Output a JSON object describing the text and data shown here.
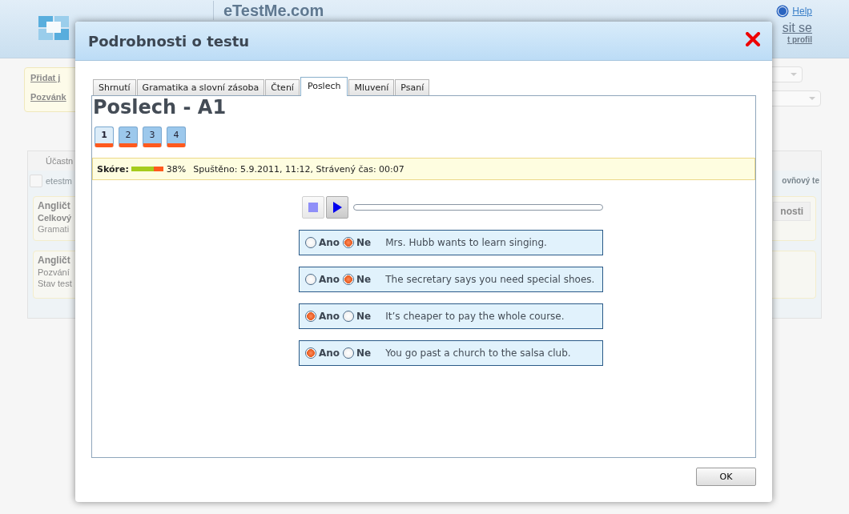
{
  "background": {
    "site_title": "eTestMe.com",
    "help": "Help",
    "login": "sit se",
    "profile": "t profil",
    "invite_box": [
      "Přidat j",
      "Pozvánk"
    ],
    "table": {
      "column_1": "Účastn",
      "row_1": "etestm",
      "right_header": "ovňový te",
      "cards": [
        {
          "title": "Angličt",
          "lines": [
            "Celkový",
            "Gramati"
          ],
          "button": "nosti"
        },
        {
          "title": "Angličt",
          "lines": [
            "Pozvání",
            "Stav test"
          ]
        }
      ]
    }
  },
  "dialog": {
    "title": "Podrobnosti o testu",
    "tabs": [
      {
        "label": "Shrnutí",
        "selected": false
      },
      {
        "label": "Gramatika a slovní zásoba",
        "selected": false
      },
      {
        "label": "Čtení",
        "selected": false
      },
      {
        "label": "Poslech",
        "selected": true
      },
      {
        "label": "Mluvení",
        "selected": false
      },
      {
        "label": "Psaní",
        "selected": false
      }
    ],
    "heading": "Poslech - A1",
    "parts": [
      {
        "label": "1",
        "selected": true
      },
      {
        "label": "2",
        "selected": false
      },
      {
        "label": "3",
        "selected": false
      },
      {
        "label": "4",
        "selected": false
      }
    ],
    "score": {
      "label": "Skóre:",
      "level": 0.7,
      "percent": "38%",
      "info": "Spuštěno: 5.9.2011, 11:12, Strávený čas: 00:07"
    },
    "player": {
      "level": 0
    },
    "statements": [
      {
        "options": [
          {
            "label": "Ano",
            "selected": false
          },
          {
            "label": "Ne",
            "selected": true
          }
        ],
        "text": "Mrs. Hubb wants to learn singing."
      },
      {
        "options": [
          {
            "label": "Ano",
            "selected": false
          },
          {
            "label": "Ne",
            "selected": true
          }
        ],
        "text": "The secretary says you need special shoes."
      },
      {
        "options": [
          {
            "label": "Ano",
            "selected": true
          },
          {
            "label": "Ne",
            "selected": false
          }
        ],
        "text": "It’s cheaper to pay the whole course."
      },
      {
        "options": [
          {
            "label": "Ano",
            "selected": true
          },
          {
            "label": "Ne",
            "selected": false
          }
        ],
        "text": "You go past a church to the salsa club."
      }
    ],
    "ok_button": "OK"
  }
}
